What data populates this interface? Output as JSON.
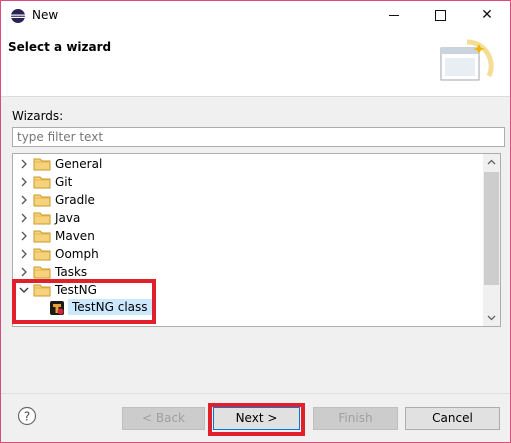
{
  "window": {
    "title": "New"
  },
  "banner": {
    "title": "Select a wizard"
  },
  "wizards": {
    "label": "Wizards:",
    "filter_placeholder": "type filter text",
    "filter_value": ""
  },
  "tree": {
    "items": [
      {
        "label": "General",
        "expanded": false
      },
      {
        "label": "Git",
        "expanded": false
      },
      {
        "label": "Gradle",
        "expanded": false
      },
      {
        "label": "Java",
        "expanded": false
      },
      {
        "label": "Maven",
        "expanded": false
      },
      {
        "label": "Oomph",
        "expanded": false
      },
      {
        "label": "Tasks",
        "expanded": false
      },
      {
        "label": "TestNG",
        "expanded": true
      }
    ],
    "selected_child": {
      "label": "TestNG class"
    }
  },
  "buttons": {
    "back": "< Back",
    "next": "Next >",
    "finish": "Finish",
    "cancel": "Cancel",
    "help": "?"
  },
  "colors": {
    "highlight": "#e0202a",
    "selection": "#cce8ff",
    "window_border": "#d94d7a"
  }
}
